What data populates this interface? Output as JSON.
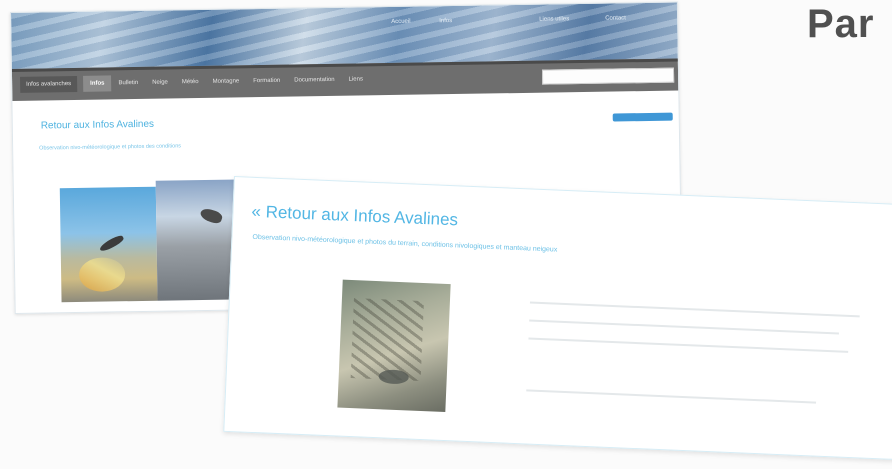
{
  "heading": "Par",
  "back_screenshot": {
    "banner_texts": [
      "Accueil",
      "Infos",
      "Liens utiles",
      "Contact"
    ],
    "brand": "Infos avalanches",
    "nav_items": [
      "Infos",
      "Bulletin",
      "Neige",
      "Météo",
      "Montagne",
      "Formation",
      "Documentation",
      "Liens"
    ],
    "back_link": "Retour aux Infos Avalines",
    "subtitle": "Observation nivo-météorologique et photos des conditions"
  },
  "front_screenshot": {
    "back_link": "« Retour aux Infos Avalines",
    "subtitle": "Observation nivo-météorologique et photos du terrain, conditions nivologiques et manteau neigeux"
  }
}
